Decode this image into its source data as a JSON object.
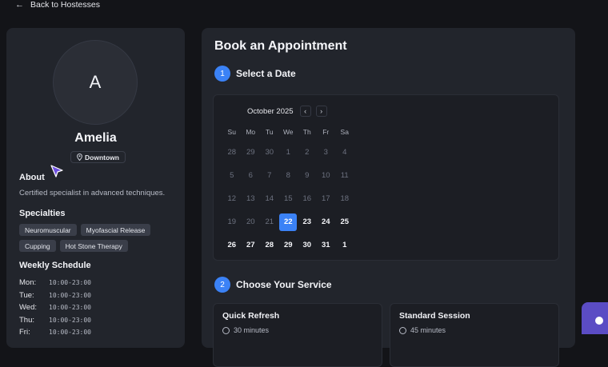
{
  "nav": {
    "back_label": "Back to Hostesses",
    "back_icon": "arrow-left-icon"
  },
  "profile": {
    "initial": "A",
    "name": "Amelia",
    "location": "Downtown",
    "about_title": "About",
    "about_text": "Certified specialist in advanced techniques.",
    "specialties_title": "Specialties",
    "specialties": [
      "Neuromuscular",
      "Myofascial Release",
      "Cupping",
      "Hot Stone Therapy"
    ],
    "schedule_title": "Weekly Schedule",
    "schedule": [
      {
        "day": "Mon:",
        "hours": "10:00-23:00"
      },
      {
        "day": "Tue:",
        "hours": "10:00-23:00"
      },
      {
        "day": "Wed:",
        "hours": "10:00-23:00"
      },
      {
        "day": "Thu:",
        "hours": "10:00-23:00"
      },
      {
        "day": "Fri:",
        "hours": "10:00-23:00"
      }
    ]
  },
  "booking": {
    "title": "Book an Appointment",
    "steps": [
      {
        "number": "1",
        "label": "Select a Date"
      },
      {
        "number": "2",
        "label": "Choose Your Service"
      }
    ],
    "calendar": {
      "month_label": "October 2025",
      "prev_icon": "chevron-left-icon",
      "next_icon": "chevron-right-icon",
      "weekdays": [
        "Su",
        "Mo",
        "Tu",
        "We",
        "Th",
        "Fr",
        "Sa"
      ],
      "weeks": [
        [
          {
            "d": "28",
            "s": "muted"
          },
          {
            "d": "29",
            "s": "muted"
          },
          {
            "d": "30",
            "s": "muted"
          },
          {
            "d": "1",
            "s": "muted"
          },
          {
            "d": "2",
            "s": "muted"
          },
          {
            "d": "3",
            "s": "muted"
          },
          {
            "d": "4",
            "s": "muted"
          }
        ],
        [
          {
            "d": "5",
            "s": "muted"
          },
          {
            "d": "6",
            "s": "muted"
          },
          {
            "d": "7",
            "s": "muted"
          },
          {
            "d": "8",
            "s": "muted"
          },
          {
            "d": "9",
            "s": "muted"
          },
          {
            "d": "10",
            "s": "muted"
          },
          {
            "d": "11",
            "s": "muted"
          }
        ],
        [
          {
            "d": "12",
            "s": "muted"
          },
          {
            "d": "13",
            "s": "muted"
          },
          {
            "d": "14",
            "s": "muted"
          },
          {
            "d": "15",
            "s": "muted"
          },
          {
            "d": "16",
            "s": "muted"
          },
          {
            "d": "17",
            "s": "muted"
          },
          {
            "d": "18",
            "s": "muted"
          }
        ],
        [
          {
            "d": "19",
            "s": "muted"
          },
          {
            "d": "20",
            "s": "muted"
          },
          {
            "d": "21",
            "s": "muted"
          },
          {
            "d": "22",
            "s": "selected"
          },
          {
            "d": "23",
            "s": "active"
          },
          {
            "d": "24",
            "s": "active"
          },
          {
            "d": "25",
            "s": "active"
          }
        ],
        [
          {
            "d": "26",
            "s": "active"
          },
          {
            "d": "27",
            "s": "active"
          },
          {
            "d": "28",
            "s": "active"
          },
          {
            "d": "29",
            "s": "active"
          },
          {
            "d": "30",
            "s": "active"
          },
          {
            "d": "31",
            "s": "active"
          },
          {
            "d": "1",
            "s": "active"
          }
        ]
      ]
    },
    "services": [
      {
        "name": "Quick Refresh",
        "duration": "30 minutes"
      },
      {
        "name": "Standard Session",
        "duration": "45 minutes"
      }
    ]
  },
  "colors": {
    "accent": "#3b82f6",
    "card": "#22252c",
    "background": "#131418",
    "chat": "#5b4cc4"
  }
}
